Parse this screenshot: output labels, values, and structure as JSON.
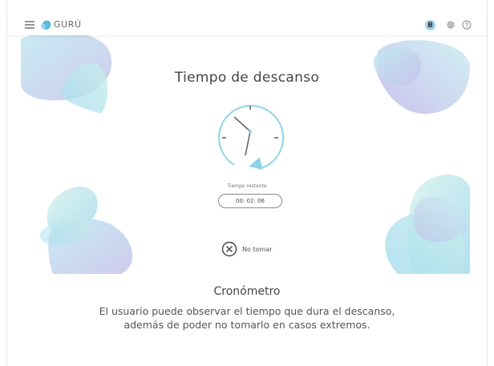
{
  "app": {
    "brand": "GURÚ",
    "user_initial": "B",
    "icons": [
      "menu-icon",
      "logo-icon",
      "settings-icon",
      "help-icon",
      "clock-icon",
      "close-circle-icon"
    ]
  },
  "colors": {
    "accent": "#8fd3e8",
    "brand_blue": "#5ab8dc",
    "avatar_bg": "#9fd1ea"
  },
  "screen": {
    "title": "Tiempo de descanso",
    "remaining_label": "Tiempo restante",
    "timer_value": "00: 02: 06",
    "skip_label": "No tomar"
  },
  "caption": {
    "title": "Cronómetro",
    "description": "El usuario puede observar el tiempo que dura el descanso, además de poder no tomarlo en casos extremos."
  }
}
